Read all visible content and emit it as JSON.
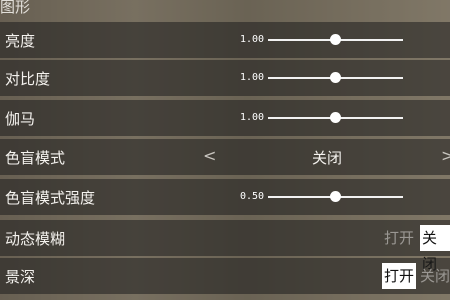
{
  "section": {
    "title": "图形"
  },
  "settings": {
    "brightness": {
      "label": "亮度",
      "value": "1.00",
      "level": 0.5
    },
    "contrast": {
      "label": "对比度",
      "value": "1.00",
      "level": 0.5
    },
    "gamma": {
      "label": "伽马",
      "value": "1.00",
      "level": 0.5
    },
    "colorblind_mode": {
      "label": "色盲模式",
      "prev": "<",
      "value": "关闭",
      "next": ">"
    },
    "colorblind_strength": {
      "label": "色盲模式强度",
      "value": "0.50",
      "level": 0.5
    },
    "motion_blur": {
      "label": "动态模糊",
      "on": "打开",
      "off": "关闭",
      "selected": "off"
    },
    "depth_of_field": {
      "label": "景深",
      "on": "打开",
      "off": "关闭",
      "selected": "on"
    }
  }
}
